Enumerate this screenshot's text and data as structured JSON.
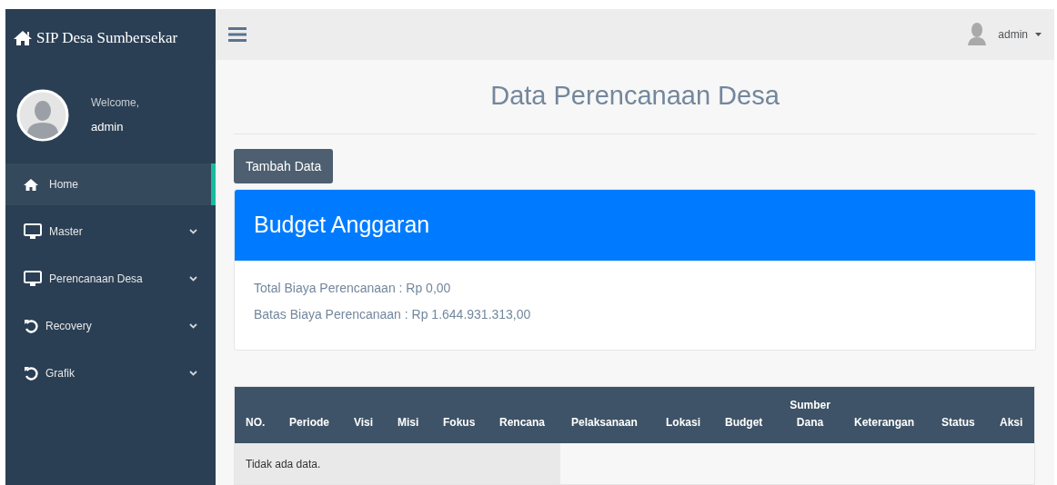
{
  "brand": {
    "title": "SIP Desa Sumbersekar"
  },
  "profile": {
    "greeting": "Welcome,",
    "name": "admin"
  },
  "sidebar": {
    "items": [
      {
        "label": "Home",
        "kind": "home",
        "selected": true,
        "expandable": false
      },
      {
        "label": "Master",
        "kind": "monitor",
        "selected": false,
        "expandable": true
      },
      {
        "label": "Perencanaan Desa",
        "kind": "monitor",
        "selected": false,
        "expandable": true
      },
      {
        "label": "Recovery",
        "kind": "undo",
        "selected": false,
        "expandable": true
      },
      {
        "label": "Grafik",
        "kind": "undo",
        "selected": false,
        "expandable": true
      }
    ]
  },
  "topbar": {
    "user": "admin"
  },
  "page": {
    "title": "Data Perencanaan Desa",
    "add_button": "Tambah Data"
  },
  "budget": {
    "title": "Budget Anggaran",
    "lines": [
      "Total Biaya Perencanaan : Rp 0,00",
      "Batas Biaya Perencanaan : Rp 1.644.931.313,00"
    ]
  },
  "table": {
    "columns": [
      "NO.",
      "Periode",
      "Visi",
      "Misi",
      "Fokus",
      "Rencana",
      "Pelaksanaan",
      "Lokasi",
      "Budget",
      "Sumber Dana",
      "Keterangan",
      "Status",
      "Aksi"
    ],
    "empty_message": "Tidak ada data."
  }
}
